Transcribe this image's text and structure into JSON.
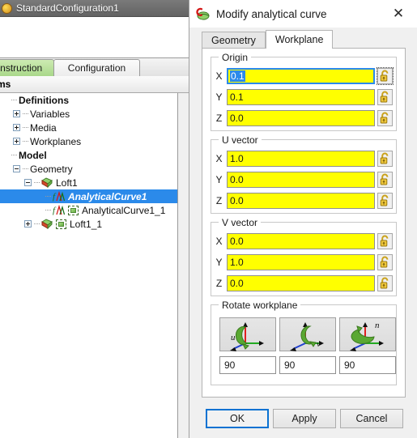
{
  "background_app": {
    "titlebar": {
      "title": "StandardConfiguration1",
      "icon": "app-sphere-icon"
    },
    "tabs": [
      {
        "label": "Construction",
        "active": true
      },
      {
        "label": "Configuration",
        "active": false
      }
    ],
    "items_header": "Items",
    "tree": [
      {
        "label": "Definitions",
        "depth": 0,
        "style": "bold",
        "expander": "none",
        "icon": "none"
      },
      {
        "label": "Variables",
        "depth": 1,
        "style": "normal",
        "expander": "plus",
        "icon": "none"
      },
      {
        "label": "Media",
        "depth": 1,
        "style": "normal",
        "expander": "plus",
        "icon": "none"
      },
      {
        "label": "Workplanes",
        "depth": 1,
        "style": "normal",
        "expander": "plus",
        "icon": "none"
      },
      {
        "label": "Model",
        "depth": 0,
        "style": "bold",
        "expander": "none",
        "icon": "none"
      },
      {
        "label": "Geometry",
        "depth": 1,
        "style": "normal",
        "expander": "minus",
        "icon": "none"
      },
      {
        "label": "Loft1",
        "depth": 2,
        "style": "normal",
        "expander": "minus",
        "icon": "loft-diamond-icon"
      },
      {
        "label": "AnalyticalCurve1",
        "depth": 3,
        "style": "bolditalic",
        "expander": "none",
        "icon": "analytical-curve-icon",
        "selected": true
      },
      {
        "label": "AnalyticalCurve1_1",
        "depth": 3,
        "style": "normal",
        "expander": "none",
        "icon": "analytical-curve-icon",
        "chip": true
      },
      {
        "label": "Loft1_1",
        "depth": 2,
        "style": "normal",
        "expander": "plus",
        "icon": "loft-diamond-icon",
        "chip": true
      }
    ]
  },
  "dialog": {
    "title": "Modify analytical curve",
    "title_icon": "curve-app-icon",
    "close_label": "✕",
    "tabs": [
      {
        "label": "Geometry",
        "active": false
      },
      {
        "label": "Workplane",
        "active": true
      }
    ],
    "groups": [
      {
        "name": "origin",
        "label": "Origin",
        "fields": [
          {
            "axis": "X",
            "value": "0.1",
            "focused": true,
            "lock": "unlocked-lock-icon",
            "lock_focused": true
          },
          {
            "axis": "Y",
            "value": "0.1",
            "focused": false,
            "lock": "unlocked-lock-icon",
            "lock_focused": false
          },
          {
            "axis": "Z",
            "value": "0.0",
            "focused": false,
            "lock": "unlocked-lock-icon",
            "lock_focused": false
          }
        ]
      },
      {
        "name": "u-vector",
        "label": "U vector",
        "fields": [
          {
            "axis": "X",
            "value": "1.0",
            "focused": false,
            "lock": "unlocked-lock-icon",
            "lock_focused": false
          },
          {
            "axis": "Y",
            "value": "0.0",
            "focused": false,
            "lock": "unlocked-lock-icon",
            "lock_focused": false
          },
          {
            "axis": "Z",
            "value": "0.0",
            "focused": false,
            "lock": "unlocked-lock-icon",
            "lock_focused": false
          }
        ]
      },
      {
        "name": "v-vector",
        "label": "V vector",
        "fields": [
          {
            "axis": "X",
            "value": "0.0",
            "focused": false,
            "lock": "unlocked-lock-icon",
            "lock_focused": false
          },
          {
            "axis": "Y",
            "value": "1.0",
            "focused": false,
            "lock": "unlocked-lock-icon",
            "lock_focused": false
          },
          {
            "axis": "Z",
            "value": "0.0",
            "focused": false,
            "lock": "unlocked-lock-icon",
            "lock_focused": false
          }
        ]
      }
    ],
    "rotate": {
      "label": "Rotate workplane",
      "buttons": [
        {
          "icon": "rotate-about-u-icon",
          "axis_letter": "u",
          "angle": "90"
        },
        {
          "icon": "rotate-about-v-icon",
          "axis_letter": "v",
          "angle": "90"
        },
        {
          "icon": "rotate-about-n-icon",
          "axis_letter": "n",
          "angle": "90"
        }
      ]
    },
    "buttons": [
      {
        "label": "OK",
        "primary": true
      },
      {
        "label": "Apply",
        "primary": false
      },
      {
        "label": "Cancel",
        "primary": false
      }
    ]
  },
  "colors": {
    "highlight_blue": "#2b8aea",
    "field_yellow": "#ffff00",
    "tab_green": "#a9d88a",
    "focus_blue": "#0a72d2",
    "axis_red": "#e02020",
    "axis_green": "#22aa22",
    "axis_blue": "#2040d0",
    "rotate_arrow_green": "#5aa832"
  }
}
